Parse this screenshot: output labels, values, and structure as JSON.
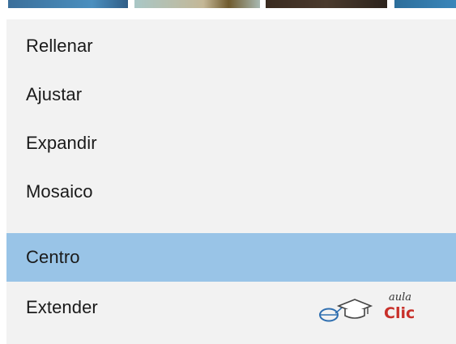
{
  "menu": {
    "items": [
      {
        "label": "Rellenar"
      },
      {
        "label": "Ajustar"
      },
      {
        "label": "Expandir"
      },
      {
        "label": "Mosaico"
      },
      {
        "label": "Centro",
        "selected": true
      },
      {
        "label": "Extender"
      }
    ],
    "selected_index": 4
  },
  "logo": {
    "text_top": "aula",
    "text_bottom": "Clic",
    "icon": "mouse-graduation-cap-icon"
  },
  "colors": {
    "menu_background": "#f2f2f2",
    "selected_background": "#99c4e7",
    "text": "#1a1a1a",
    "logo_red": "#c8302a",
    "logo_blue": "#2f6fb0"
  }
}
